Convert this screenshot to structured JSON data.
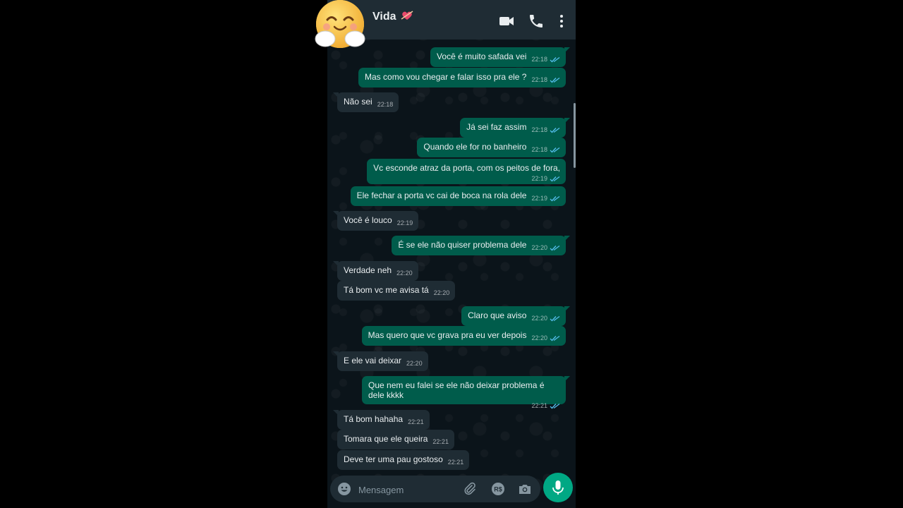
{
  "header": {
    "contact_name": "Vida"
  },
  "icons": {
    "header": [
      "video-call-icon",
      "phone-icon",
      "more-options-icon"
    ],
    "input": [
      "emoji-icon",
      "attach-icon",
      "payment-icon",
      "camera-icon",
      "mic-icon"
    ]
  },
  "messages": [
    {
      "dir": "out",
      "text": "Você é muito safada vei",
      "time": "22:18",
      "read": true
    },
    {
      "dir": "out",
      "text": "Mas como vou chegar e falar isso pra ele ?",
      "time": "22:18",
      "read": true
    },
    {
      "dir": "in",
      "text": "Não sei",
      "time": "22:18"
    },
    {
      "dir": "out",
      "text": "Já sei faz assim",
      "time": "22:18",
      "read": true
    },
    {
      "dir": "out",
      "text": "Quando ele for no banheiro",
      "time": "22:18",
      "read": true
    },
    {
      "dir": "out",
      "text": "Vc esconde atraz da porta, com os peitos de fora,",
      "time": "22:19",
      "read": true
    },
    {
      "dir": "out",
      "text": "Ele fechar a porta vc cai de boca na rola dele",
      "time": "22:19",
      "read": true
    },
    {
      "dir": "in",
      "text": "Você é louco",
      "time": "22:19"
    },
    {
      "dir": "out",
      "text": "É se ele não quiser problema dele",
      "time": "22:20",
      "read": true
    },
    {
      "dir": "in",
      "text": "Verdade neh",
      "time": "22:20"
    },
    {
      "dir": "in",
      "text": "Tá bom vc me avisa tá",
      "time": "22:20"
    },
    {
      "dir": "out",
      "text": "Claro que aviso",
      "time": "22:20",
      "read": true
    },
    {
      "dir": "out",
      "text": "Mas quero que vc grava pra eu ver depois",
      "time": "22:20",
      "read": true
    },
    {
      "dir": "in",
      "text": "E ele vai deixar",
      "time": "22:20"
    },
    {
      "dir": "out",
      "text": "Que nem eu falei se ele não deixar problema é dele kkkk",
      "time": "22:21",
      "read": true
    },
    {
      "dir": "in",
      "text": "Tá bom hahaha",
      "time": "22:21"
    },
    {
      "dir": "in",
      "text": "Tomara que ele queira",
      "time": "22:21"
    },
    {
      "dir": "in",
      "text": "Deve ter uma pau gostoso",
      "time": "22:21"
    }
  ],
  "input": {
    "placeholder": "Mensagem"
  },
  "colors": {
    "background": "#0b141a",
    "header": "#1f2c34",
    "outgoing_bubble": "#005c4b",
    "incoming_bubble": "#1f2c34",
    "accent": "#00a884",
    "read_ticks": "#53bdeb"
  }
}
